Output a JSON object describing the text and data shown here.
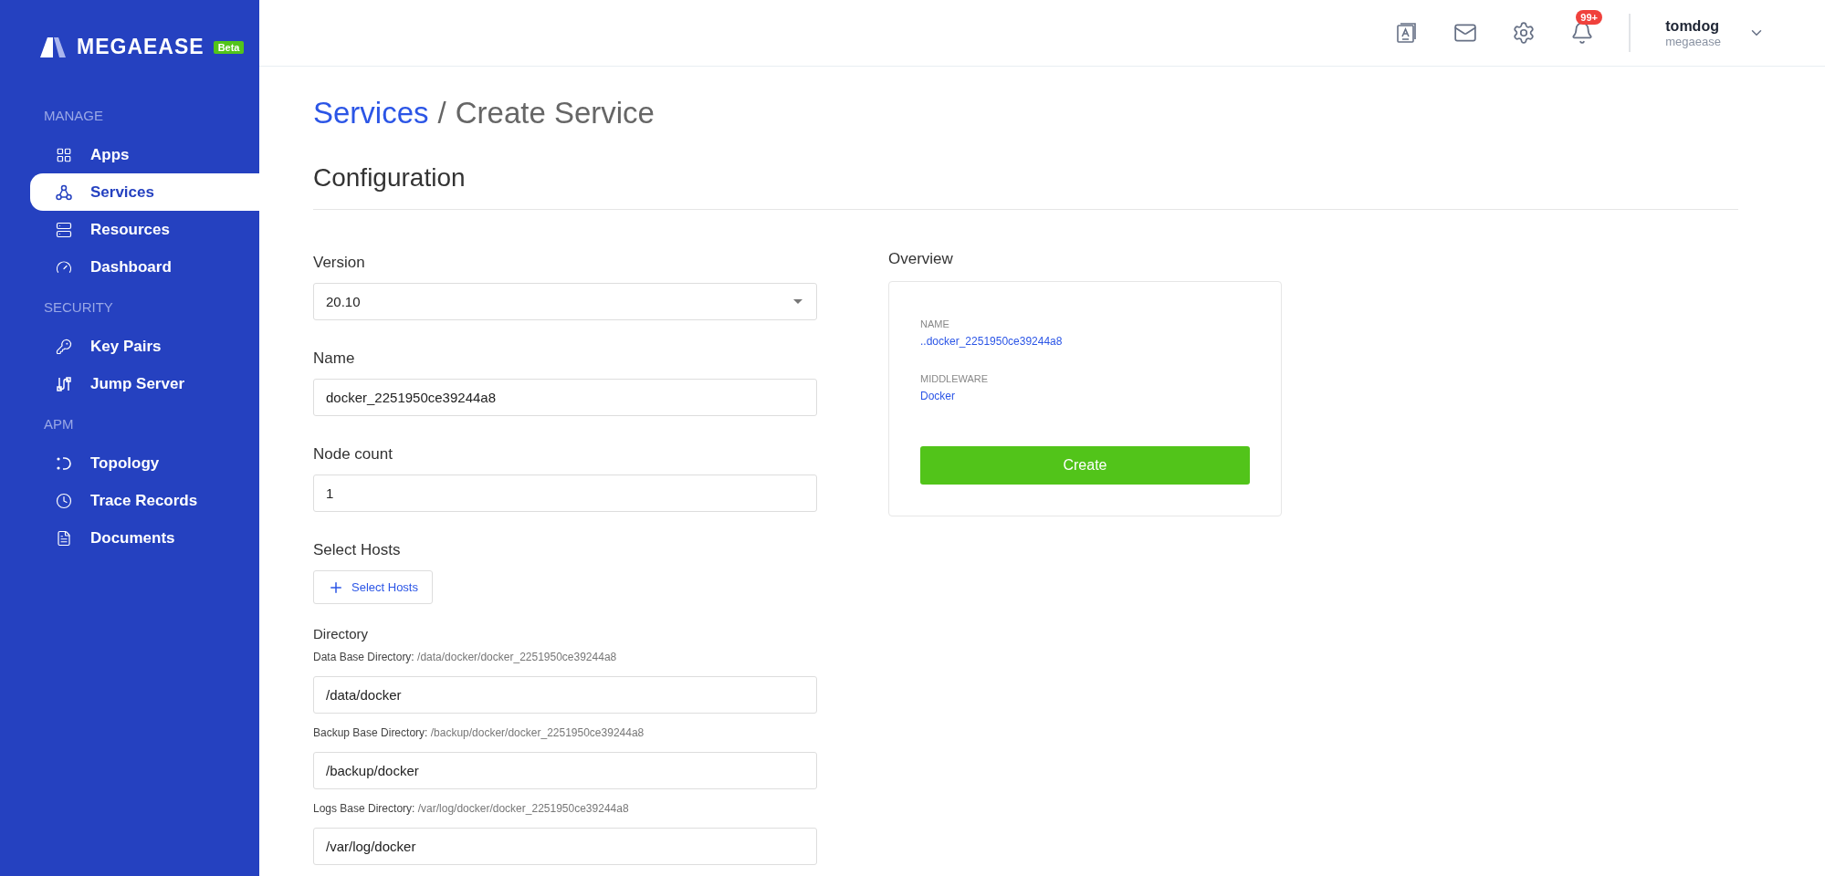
{
  "logo": {
    "text": "MEGAEASE",
    "badge": "Beta"
  },
  "sidebar": {
    "sections": [
      {
        "title": "MANAGE",
        "items": [
          {
            "label": "Apps",
            "kind": "apps",
            "selected": false
          },
          {
            "label": "Services",
            "kind": "services",
            "selected": true
          },
          {
            "label": "Resources",
            "kind": "resources",
            "selected": false
          },
          {
            "label": "Dashboard",
            "kind": "dashboard",
            "selected": false
          }
        ]
      },
      {
        "title": "SECURITY",
        "items": [
          {
            "label": "Key Pairs",
            "kind": "key",
            "selected": false
          },
          {
            "label": "Jump Server",
            "kind": "jump",
            "selected": false
          }
        ]
      },
      {
        "title": "APM",
        "items": [
          {
            "label": "Topology",
            "kind": "topology",
            "selected": false
          },
          {
            "label": "Trace Records",
            "kind": "clock",
            "selected": false
          },
          {
            "label": "Documents",
            "kind": "document",
            "selected": false
          }
        ]
      }
    ]
  },
  "header": {
    "notification_badge": "99+",
    "user": {
      "name": "tomdog",
      "org": "megaease"
    }
  },
  "breadcrumb": {
    "parent": "Services",
    "separator": "/",
    "current": "Create Service"
  },
  "section_title": "Configuration",
  "form": {
    "fields": [
      {
        "kind": "select",
        "label": "Version",
        "value": "20.10"
      },
      {
        "kind": "input",
        "label": "Name",
        "value": "docker_2251950ce39244a8"
      },
      {
        "kind": "input",
        "label": "Node count",
        "value": "1"
      },
      {
        "kind": "button",
        "label": "Select Hosts",
        "button": "Select Hosts"
      }
    ],
    "directory": {
      "label": "Directory",
      "entries": [
        {
          "label": "Data Base Directory:",
          "path": "/data/docker/docker_2251950ce39244a8",
          "value": "/data/docker"
        },
        {
          "label": "Backup Base Directory:",
          "path": "/backup/docker/docker_2251950ce39244a8",
          "value": "/backup/docker"
        },
        {
          "label": "Logs Base Directory:",
          "path": "/var/log/docker/docker_2251950ce39244a8",
          "value": "/var/log/docker"
        }
      ]
    }
  },
  "overview": {
    "title": "Overview",
    "items": [
      {
        "label": "NAME",
        "value": "..docker_2251950ce39244a8"
      },
      {
        "label": "MIDDLEWARE",
        "value": "Docker"
      }
    ],
    "button": "Create"
  }
}
